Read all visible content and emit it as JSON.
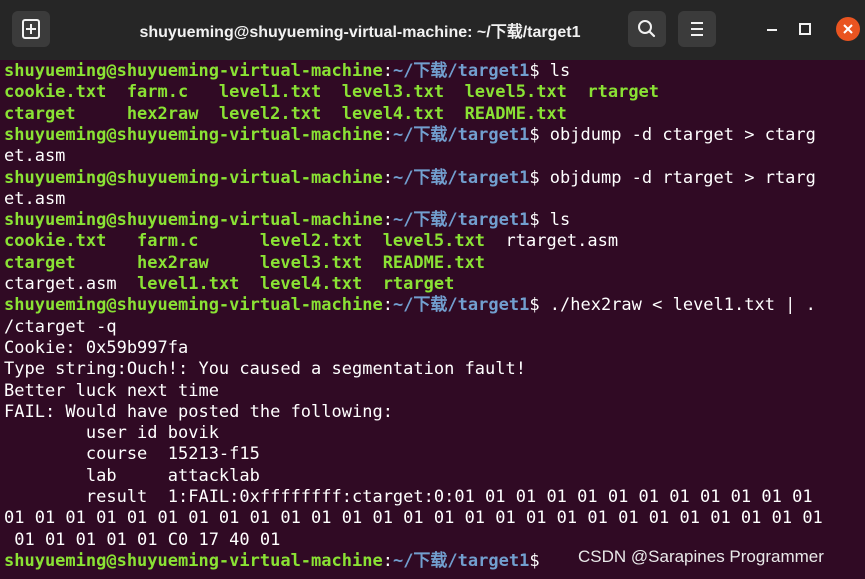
{
  "window": {
    "title": "shuyueming@shuyueming-virtual-machine: ~/下载/target1"
  },
  "terminal": {
    "lines": [
      [
        {
          "c": "u",
          "t": "shuyueming@shuyueming-virtual-machine"
        },
        {
          "c": "w",
          "t": ":"
        },
        {
          "c": "p",
          "t": "~/下载/target1"
        },
        {
          "c": "w",
          "t": "$ ls"
        }
      ],
      [
        {
          "c": "g",
          "t": "cookie.txt  farm.c   level1.txt  level3.txt  level5.txt  rtarget"
        }
      ],
      [
        {
          "c": "g",
          "t": "ctarget     hex2raw  level2.txt  level4.txt  README.txt"
        }
      ],
      [
        {
          "c": "u",
          "t": "shuyueming@shuyueming-virtual-machine"
        },
        {
          "c": "w",
          "t": ":"
        },
        {
          "c": "p",
          "t": "~/下载/target1"
        },
        {
          "c": "w",
          "t": "$ objdump -d ctarget > ctarg"
        }
      ],
      [
        {
          "c": "w",
          "t": "et.asm"
        }
      ],
      [
        {
          "c": "u",
          "t": "shuyueming@shuyueming-virtual-machine"
        },
        {
          "c": "w",
          "t": ":"
        },
        {
          "c": "p",
          "t": "~/下载/target1"
        },
        {
          "c": "w",
          "t": "$ objdump -d rtarget > rtarg"
        }
      ],
      [
        {
          "c": "w",
          "t": "et.asm"
        }
      ],
      [
        {
          "c": "u",
          "t": "shuyueming@shuyueming-virtual-machine"
        },
        {
          "c": "w",
          "t": ":"
        },
        {
          "c": "p",
          "t": "~/下载/target1"
        },
        {
          "c": "w",
          "t": "$ ls"
        }
      ],
      [
        {
          "c": "g",
          "t": "cookie.txt   farm.c      level2.txt  level5.txt  "
        },
        {
          "c": "w",
          "t": "rtarget.asm"
        }
      ],
      [
        {
          "c": "g",
          "t": "ctarget      hex2raw     level3.txt  README.txt"
        }
      ],
      [
        {
          "c": "w",
          "t": "ctarget.asm  "
        },
        {
          "c": "g",
          "t": "level1.txt  level4.txt  rtarget"
        }
      ],
      [
        {
          "c": "u",
          "t": "shuyueming@shuyueming-virtual-machine"
        },
        {
          "c": "w",
          "t": ":"
        },
        {
          "c": "p",
          "t": "~/下载/target1"
        },
        {
          "c": "w",
          "t": "$ ./hex2raw < level1.txt | ."
        }
      ],
      [
        {
          "c": "w",
          "t": "/ctarget -q"
        }
      ],
      [
        {
          "c": "w",
          "t": "Cookie: 0x59b997fa"
        }
      ],
      [
        {
          "c": "w",
          "t": "Type string:Ouch!: You caused a segmentation fault!"
        }
      ],
      [
        {
          "c": "w",
          "t": "Better luck next time"
        }
      ],
      [
        {
          "c": "w",
          "t": "FAIL: Would have posted the following:"
        }
      ],
      [
        {
          "c": "w",
          "t": "        user id bovik"
        }
      ],
      [
        {
          "c": "w",
          "t": "        course  15213-f15"
        }
      ],
      [
        {
          "c": "w",
          "t": "        lab     attacklab"
        }
      ],
      [
        {
          "c": "w",
          "t": "        result  1:FAIL:0xffffffff:ctarget:0:01 01 01 01 01 01 01 01 01 01 01 01"
        }
      ],
      [
        {
          "c": "w",
          "t": "01 01 01 01 01 01 01 01 01 01 01 01 01 01 01 01 01 01 01 01 01 01 01 01 01 01 01"
        }
      ],
      [
        {
          "c": "w",
          "t": " 01 01 01 01 01 C0 17 40 01"
        }
      ],
      [
        {
          "c": "u",
          "t": "shuyueming@shuyueming-virtual-machine"
        },
        {
          "c": "w",
          "t": ":"
        },
        {
          "c": "p",
          "t": "~/下载/target1"
        },
        {
          "c": "w",
          "t": "$ "
        }
      ]
    ]
  },
  "watermark": {
    "text": "CSDN @Sarapines Programmer"
  },
  "icons": {
    "new_tab": "new-tab-icon",
    "search": "search-icon",
    "menu": "hamburger-menu-icon",
    "minimize": "minimize-icon",
    "maximize": "maximize-icon",
    "close": "close-icon"
  },
  "colors": {
    "titlebar": "#262626",
    "terminal_bg": "#300a24",
    "user_host": "#8ae234",
    "path": "#729fcf",
    "text": "#ffffff",
    "close_button": "#e95420"
  }
}
